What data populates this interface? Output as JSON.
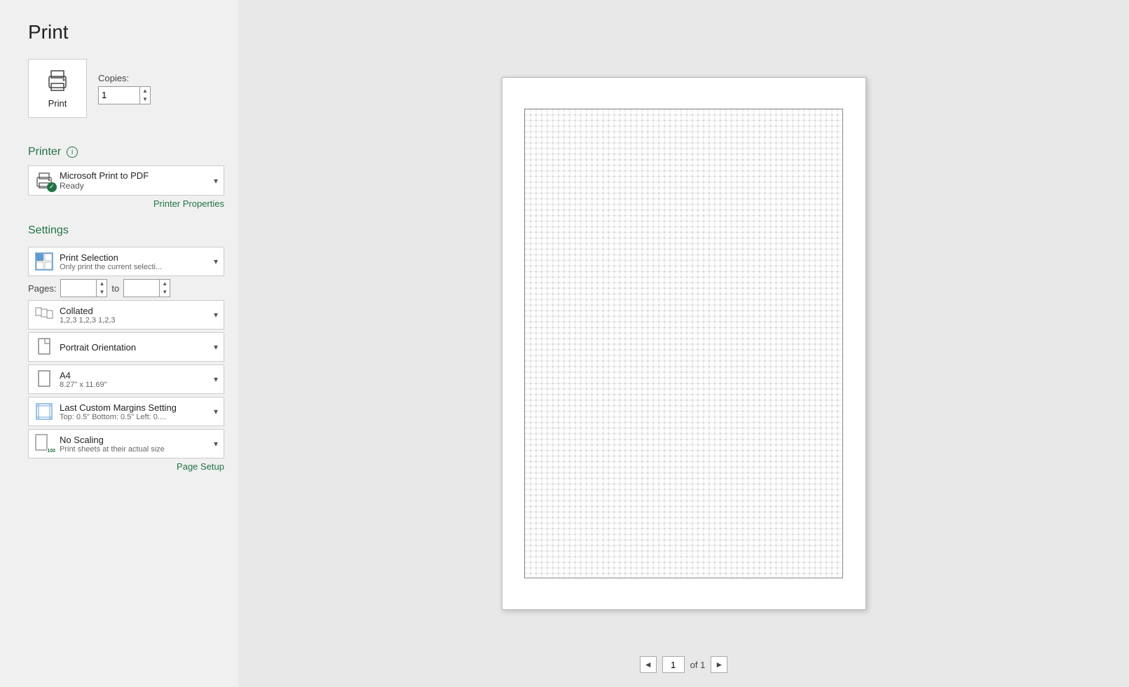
{
  "page": {
    "title": "Print"
  },
  "print_button": {
    "label": "Print"
  },
  "copies": {
    "label": "Copies:",
    "value": "1"
  },
  "printer_section": {
    "title": "Printer",
    "info_icon": "ⓘ",
    "printer_name": "Microsoft Print to PDF",
    "printer_status": "Ready",
    "dropdown_arrow": "▾",
    "properties_link": "Printer Properties"
  },
  "settings_section": {
    "title": "Settings",
    "print_selection": {
      "main": "Print Selection",
      "sub": "Only print the current selecti..."
    },
    "pages_label": "Pages:",
    "pages_to": "to",
    "collated": {
      "main": "Collated",
      "sub": "1,2,3   1,2,3   1,2,3"
    },
    "orientation": {
      "main": "Portrait Orientation",
      "sub": ""
    },
    "paper_size": {
      "main": "A4",
      "sub": "8.27\" x 11.69\""
    },
    "margins": {
      "main": "Last Custom Margins Setting",
      "sub": "Top: 0.5\" Bottom: 0.5\" Left: 0...."
    },
    "scaling": {
      "main": "No Scaling",
      "sub": "Print sheets at their actual size"
    },
    "page_setup_link": "Page Setup"
  },
  "pagination": {
    "current_page": "1",
    "of_text": "of 1",
    "prev_arrow": "◄",
    "next_arrow": "►"
  }
}
